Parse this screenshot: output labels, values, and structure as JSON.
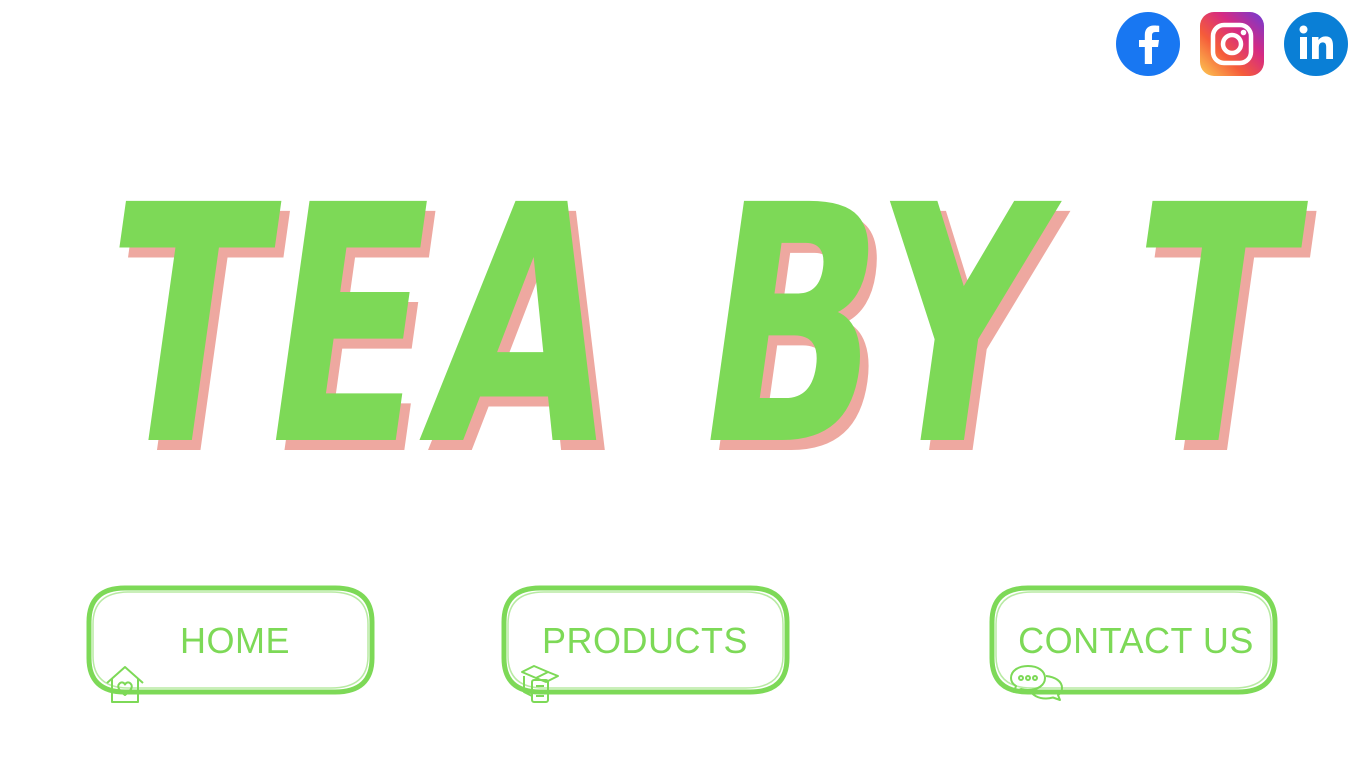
{
  "colors": {
    "accent_green": "#7dd957",
    "shadow_pink": "#eea8a0",
    "facebook_blue": "#1877f2",
    "linkedin_blue": "#0a7fd6"
  },
  "social": [
    {
      "name": "facebook",
      "icon": "facebook-icon"
    },
    {
      "name": "instagram",
      "icon": "instagram-icon"
    },
    {
      "name": "linkedin",
      "icon": "linkedin-icon"
    }
  ],
  "hero": {
    "title": "TEA BY T"
  },
  "nav": {
    "home": {
      "label": "HOME",
      "icon": "house-heart-icon"
    },
    "products": {
      "label": "PRODUCTS",
      "icon": "box-list-icon"
    },
    "contact": {
      "label": "CONTACT US",
      "icon": "chat-bubbles-icon"
    }
  }
}
